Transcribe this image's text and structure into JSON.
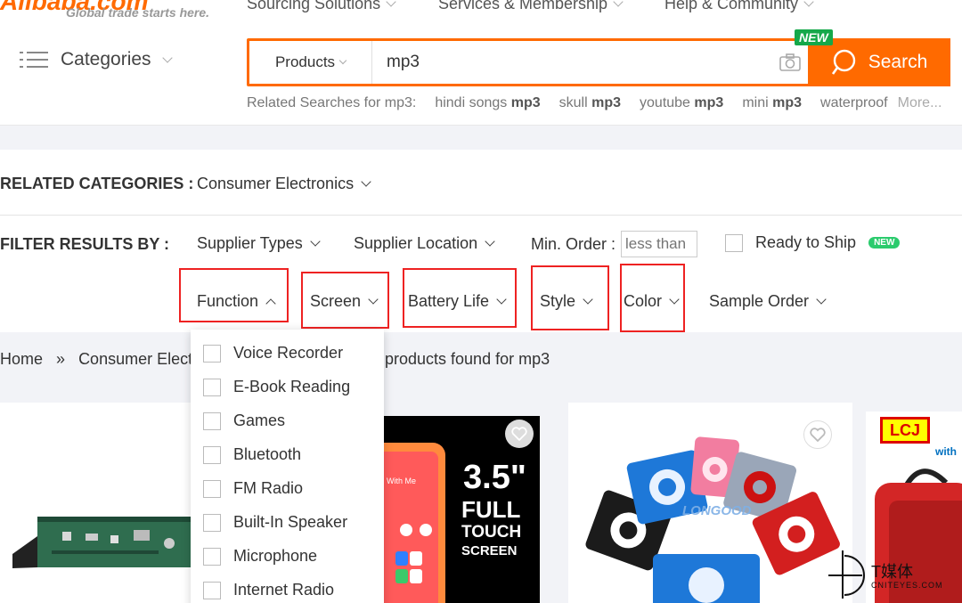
{
  "header": {
    "logo_text": "Alibaba.com",
    "tagline": "Global trade starts here.",
    "nav": [
      {
        "label": "Sourcing Solutions"
      },
      {
        "label": "Services & Membership"
      },
      {
        "label": "Help & Community"
      }
    ],
    "categories_label": "Categories"
  },
  "search": {
    "category_select": "Products",
    "query": "mp3",
    "button_label": "Search",
    "new_badge": "NEW",
    "icons": {
      "camera": "camera-icon",
      "search": "search-icon"
    },
    "related_prefix": "Related Searches for mp3:",
    "related": [
      {
        "plain": "hindi songs",
        "bold": "mp3"
      },
      {
        "plain": "skull",
        "bold": "mp3"
      },
      {
        "plain": "youtube",
        "bold": "mp3"
      },
      {
        "plain": "mini",
        "bold": "mp3"
      },
      {
        "plain": "waterproof",
        "bold": ""
      }
    ],
    "more_label": "More..."
  },
  "related_categories": {
    "label": "RELATED CATEGORIES :",
    "value": "Consumer Electronics"
  },
  "filters": {
    "label": "FILTER RESULTS BY :",
    "supplier_types": "Supplier Types",
    "supplier_location": "Supplier Location",
    "min_order_label": "Min. Order :",
    "min_order_placeholder": "less than",
    "ready_to_ship": "Ready to Ship",
    "ready_badge": "NEW",
    "function": "Function",
    "screen": "Screen",
    "battery_life": "Battery Life",
    "style": "Style",
    "color": "Color",
    "sample_order": "Sample Order"
  },
  "dropdown": {
    "options": [
      {
        "label": "Voice Recorder"
      },
      {
        "label": "E-Book Reading"
      },
      {
        "label": "Games"
      },
      {
        "label": "Bluetooth"
      },
      {
        "label": "FM Radio"
      },
      {
        "label": "Built-In Speaker"
      },
      {
        "label": "Microphone"
      },
      {
        "label": "Internet Radio"
      }
    ]
  },
  "breadcrumb": {
    "home": "Home",
    "separator": "»",
    "current": "Consumer Elect",
    "results_text": "products found for mp3"
  },
  "products": {
    "card2": {
      "line1": "3.5\"",
      "line2": "FULL",
      "line3": "TOUCH",
      "line4": "SCREEN",
      "phone_caption": "With Me"
    },
    "card3": {
      "brand": "LONGOOD"
    },
    "card4": {
      "logo": "LCJ",
      "with": "with"
    }
  },
  "watermark": {
    "big": "T媒体",
    "small": "CNITEYES.COM"
  },
  "colors": {
    "accent": "#ff6a00",
    "new_badge": "#15a84a",
    "highlight": "#ee2222"
  }
}
